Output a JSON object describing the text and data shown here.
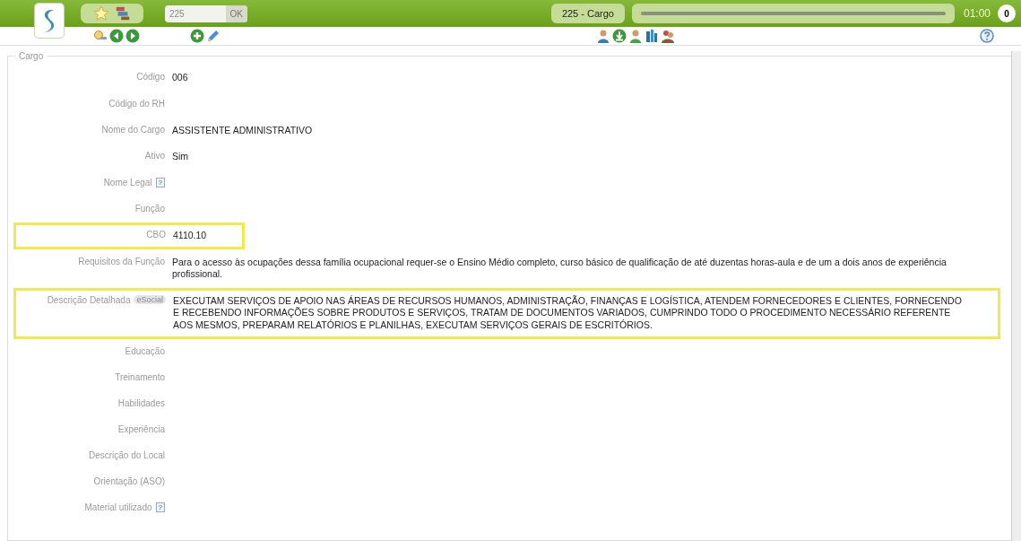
{
  "header": {
    "search_value": "225",
    "ok_label": "OK",
    "page_badge": "225 - Cargo",
    "timer": "01:00",
    "notifications": "0"
  },
  "section_title": "Cargo",
  "fields": [
    {
      "label": "Código",
      "value": "006",
      "highlighted": false
    },
    {
      "label": "Código do RH",
      "highlighted": false
    },
    {
      "label": "Nome do Cargo",
      "value": "ASSISTENTE ADMINISTRATIVO",
      "highlighted": false
    },
    {
      "label": "Ativo",
      "value": "Sim",
      "highlighted": false
    },
    {
      "label": "Nome Legal",
      "help": "?",
      "highlighted": false
    },
    {
      "label": "Função",
      "highlighted": false
    },
    {
      "label": "CBO",
      "value": "4110.10",
      "highlighted": true
    },
    {
      "label": "Requisitos da Função",
      "value": "Para o acesso às ocupações dessa família ocupacional requer-se o Ensino Médio completo, curso básico de qualificação de até duzentas horas-aula e de um a dois anos de experiência profissional.",
      "highlighted": false
    },
    {
      "label": "Descrição Detalhada",
      "tag": "eSocial",
      "value": "EXECUTAM SERVIÇOS DE APOIO NAS ÁREAS DE RECURSOS HUMANOS, ADMINISTRAÇÃO, FINANÇAS E LOGÍSTICA, ATENDEM FORNECEDORES E CLIENTES, FORNECENDO E RECEBENDO INFORMAÇÕES SOBRE PRODUTOS E SERVIÇOS, TRATAM DE DOCUMENTOS VARIADOS, CUMPRINDO TODO O PROCEDIMENTO NECESSÁRIO REFERENTE AOS MESMOS, PREPARAM RELATÓRIOS E PLANILHAS, EXECUTAM SERVIÇOS GERAIS DE ESCRITÓRIOS.",
      "highlighted": true
    },
    {
      "label": "Educação",
      "highlighted": false
    },
    {
      "label": "Treinamento",
      "highlighted": false
    },
    {
      "label": "Habilidades",
      "highlighted": false
    },
    {
      "label": "Experiência",
      "highlighted": false
    },
    {
      "label": "Descrição do Local",
      "highlighted": false
    },
    {
      "label": "Orientação (ASO)",
      "highlighted": false
    },
    {
      "label": "Material utilizado",
      "help": "?",
      "highlighted": false
    }
  ]
}
